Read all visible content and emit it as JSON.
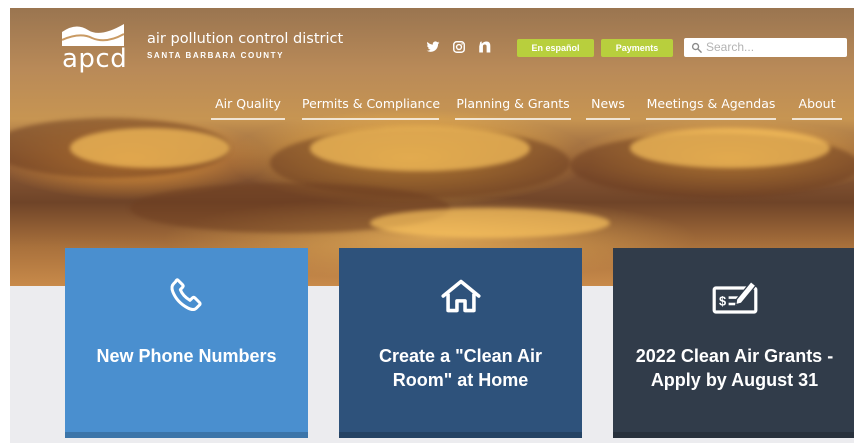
{
  "header": {
    "logo_text": "apcd",
    "org_name": "air pollution control district",
    "county": "SANTA BARBARA COUNTY",
    "spanish_label": "En español",
    "payments_label": "Payments",
    "search_placeholder": "Search..."
  },
  "social": [
    "twitter-icon",
    "instagram-icon",
    "nextdoor-icon"
  ],
  "nav": [
    {
      "label": "Air Quality"
    },
    {
      "label": "Permits & Compliance"
    },
    {
      "label": "Planning & Grants"
    },
    {
      "label": "News"
    },
    {
      "label": "Meetings & Agendas"
    },
    {
      "label": "About"
    }
  ],
  "cards": [
    {
      "title": "New Phone Numbers",
      "icon": "phone-icon",
      "color": "#4a8fcf"
    },
    {
      "title": "Create a \"Clean Air Room\" at Home",
      "icon": "home-icon",
      "color": "#2e527b"
    },
    {
      "title": "2022 Clean Air Grants - Apply by August 31",
      "icon": "money-check-icon",
      "color": "#313c4a"
    }
  ],
  "colors": {
    "accent_green": "#b8cf3d",
    "card_blue": "#4a8fcf",
    "card_navy": "#2e527b",
    "card_slate": "#313c4a"
  }
}
